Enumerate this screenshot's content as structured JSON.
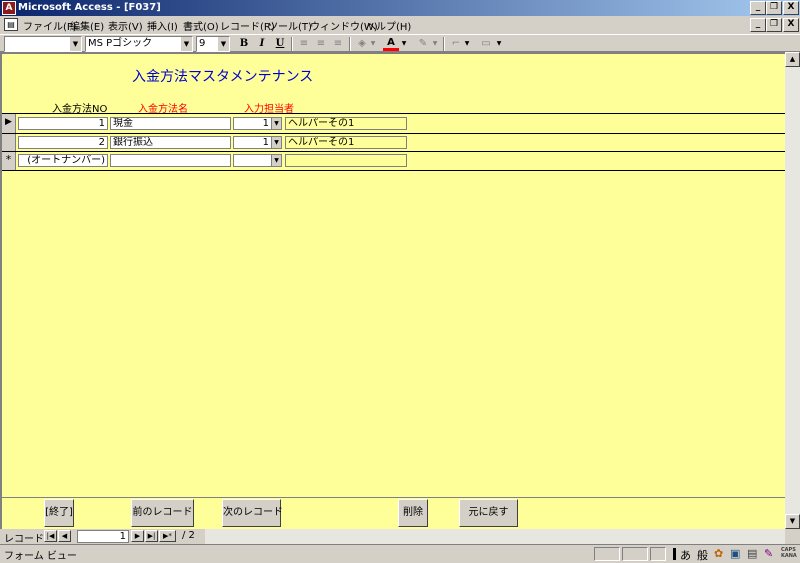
{
  "window": {
    "title": "Microsoft Access - [F037]",
    "app_icon": "access-icon",
    "controls": [
      "_",
      "🗗",
      "X"
    ],
    "doc_controls": [
      "_",
      "🗗",
      "X"
    ]
  },
  "menu": {
    "items": [
      "ファイル(F)",
      "編集(E)",
      "表示(V)",
      "挿入(I)",
      "書式(O)",
      "レコード(R)",
      "ツール(T)",
      "ウィンドウ(W)",
      "ヘルプ(H)"
    ]
  },
  "toolbar": {
    "object_combo": "",
    "font_name": "MS Pゴシック",
    "font_size": "9",
    "bold": "B",
    "italic": "I",
    "underline": "U"
  },
  "form": {
    "title": "入金方法マスタメンテナンス",
    "columns": {
      "no": "入金方法NO",
      "name": "入金方法名",
      "staff": "入力担当者"
    },
    "rows": [
      {
        "selector": "▶",
        "no": "1",
        "name": "現金",
        "staff_id": "1",
        "staff_name": "ヘルパーその1"
      },
      {
        "selector": "",
        "no": "2",
        "name": "銀行振込",
        "staff_id": "1",
        "staff_name": "ヘルパーその1"
      },
      {
        "selector": "*",
        "no": "(オートナンバー)",
        "name": "",
        "staff_id": "",
        "staff_name": ""
      }
    ],
    "colors": {
      "background": "#ffff99",
      "title": "#0000cc",
      "required_label": "#ff0000"
    }
  },
  "buttons": {
    "exit": "[終了]",
    "prev": "前のレコード",
    "next": "次のレコード",
    "delete": "削除",
    "undo": "元に戻す"
  },
  "nav": {
    "label": "レコード:",
    "current": "1",
    "total": "/ 2"
  },
  "status": {
    "view": "フォーム ビュー",
    "ime_mode": "あ",
    "ime_conv": "般",
    "caps": "CAPS",
    "kana": "KANA"
  }
}
